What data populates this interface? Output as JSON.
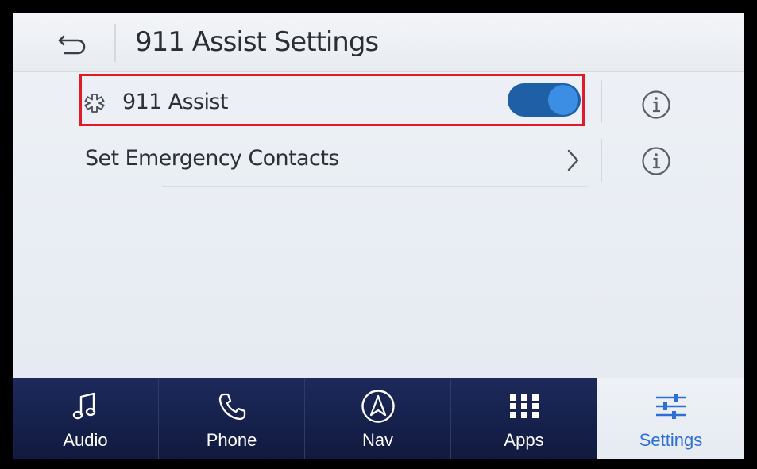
{
  "header": {
    "title": "911 Assist Settings",
    "back_icon": "back-arrow-icon"
  },
  "rows": [
    {
      "label": "911 Assist",
      "icon": "medical-star-icon",
      "toggle": "on",
      "highlighted": true,
      "info_icon": "info-icon"
    },
    {
      "label": "Set Emergency Contacts",
      "action_icon": "chevron-right-icon",
      "info_icon": "info-icon"
    }
  ],
  "nav": {
    "items": [
      {
        "label": "Audio",
        "icon": "music-note-icon"
      },
      {
        "label": "Phone",
        "icon": "phone-icon"
      },
      {
        "label": "Nav",
        "icon": "compass-icon"
      },
      {
        "label": "Apps",
        "icon": "apps-grid-icon"
      },
      {
        "label": "Settings",
        "icon": "sliders-icon",
        "active": true
      }
    ]
  },
  "colors": {
    "accent": "#2d6fd6",
    "toggle_on": "#1f5fa5",
    "highlight_border": "#e01b2a",
    "nav_background": "#15204a"
  }
}
